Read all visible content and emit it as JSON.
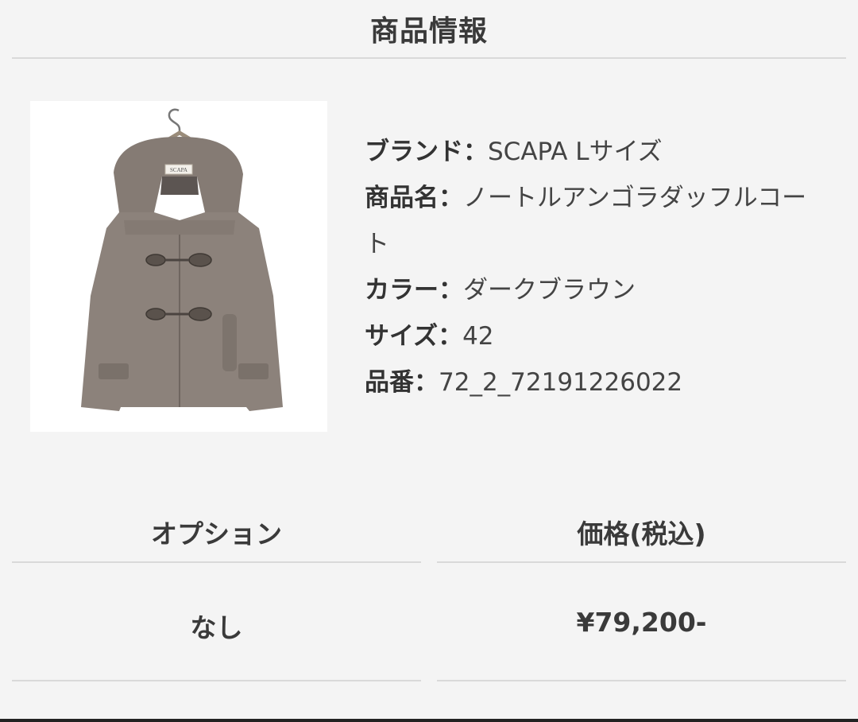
{
  "header": {
    "title": "商品情報"
  },
  "product": {
    "image_alt": "SCAPA",
    "image_label_text": "SCAPA",
    "info": [
      {
        "key": "ブランド：",
        "value": "SCAPA Lサイズ"
      },
      {
        "key": "商品名：",
        "value": "ノートルアンゴラダッフルコート"
      },
      {
        "key": "カラー：",
        "value": "ダークブラウン"
      },
      {
        "key": "サイズ：",
        "value": "42"
      },
      {
        "key": "品番：",
        "value": "72_2_72191226022"
      }
    ]
  },
  "table": {
    "columns": [
      "オプション",
      "価格(税込)"
    ],
    "rows": [
      [
        "なし",
        "¥79,200-"
      ]
    ]
  },
  "colors": {
    "background": "#f4f4f4",
    "divider": "#d9d9d9",
    "text": "#3a3a3a",
    "coat": "#8c827b"
  }
}
